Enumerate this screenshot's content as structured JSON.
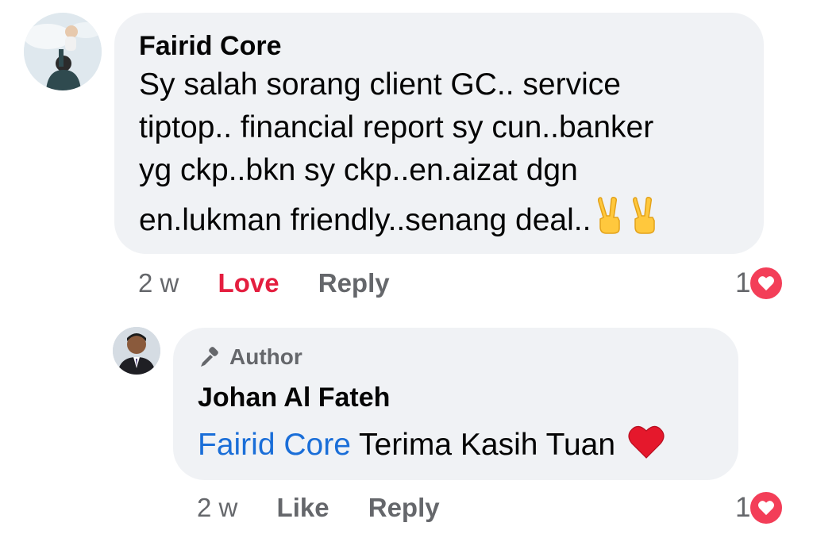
{
  "comment": {
    "author": "Fairid Core",
    "lines": [
      "Sy salah sorang client GC.. service",
      "tiptop.. financial report sy cun..banker",
      "yg ckp..bkn sy ckp..en.aizat dgn",
      "en.lukman friendly..senang deal.."
    ],
    "emoji": [
      "victory-hand-emoji",
      "victory-hand-emoji"
    ],
    "time": "2 w",
    "reaction_label": "Love",
    "reply_label": "Reply",
    "reaction_count": "1",
    "colors": {
      "love": "#e41e3f",
      "heart": "#f33e58",
      "bubble": "#f0f2f5"
    }
  },
  "reply": {
    "badge": "Author",
    "author": "Johan Al Fateh",
    "mention": "Fairid Core",
    "text": "Terima Kasih Tuan",
    "emoji": "red-heart-emoji",
    "time": "2 w",
    "like_label": "Like",
    "reply_label": "Reply",
    "reaction_count": "1",
    "colors": {
      "mention": "#1a6ed8"
    }
  }
}
